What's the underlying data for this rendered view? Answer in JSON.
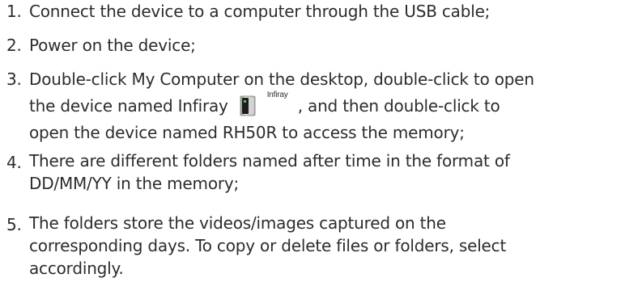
{
  "steps": [
    {
      "number": "1.",
      "text": "Connect the device to a computer through the USB cable;"
    },
    {
      "number": "2.",
      "text": "Power on the device;"
    },
    {
      "number": "3.",
      "line1": "Double-click My Computer on the desktop, double-click to open",
      "line2_before": "the device named Infiray",
      "line2_after": ", and then double-click to",
      "line3": "open the device named RH50R to access the memory;",
      "icon": {
        "name": "removable-drive-icon",
        "label": "Infiray"
      }
    },
    {
      "number": "4.",
      "line1": "There are different folders named after time in the format of",
      "line2": "DD/MM/YY in the memory;"
    },
    {
      "number": "5.",
      "line1": "The folders store the videos/images captured on the",
      "line2": "corresponding days. To copy or delete files or folders, select",
      "line3": "accordingly."
    }
  ]
}
